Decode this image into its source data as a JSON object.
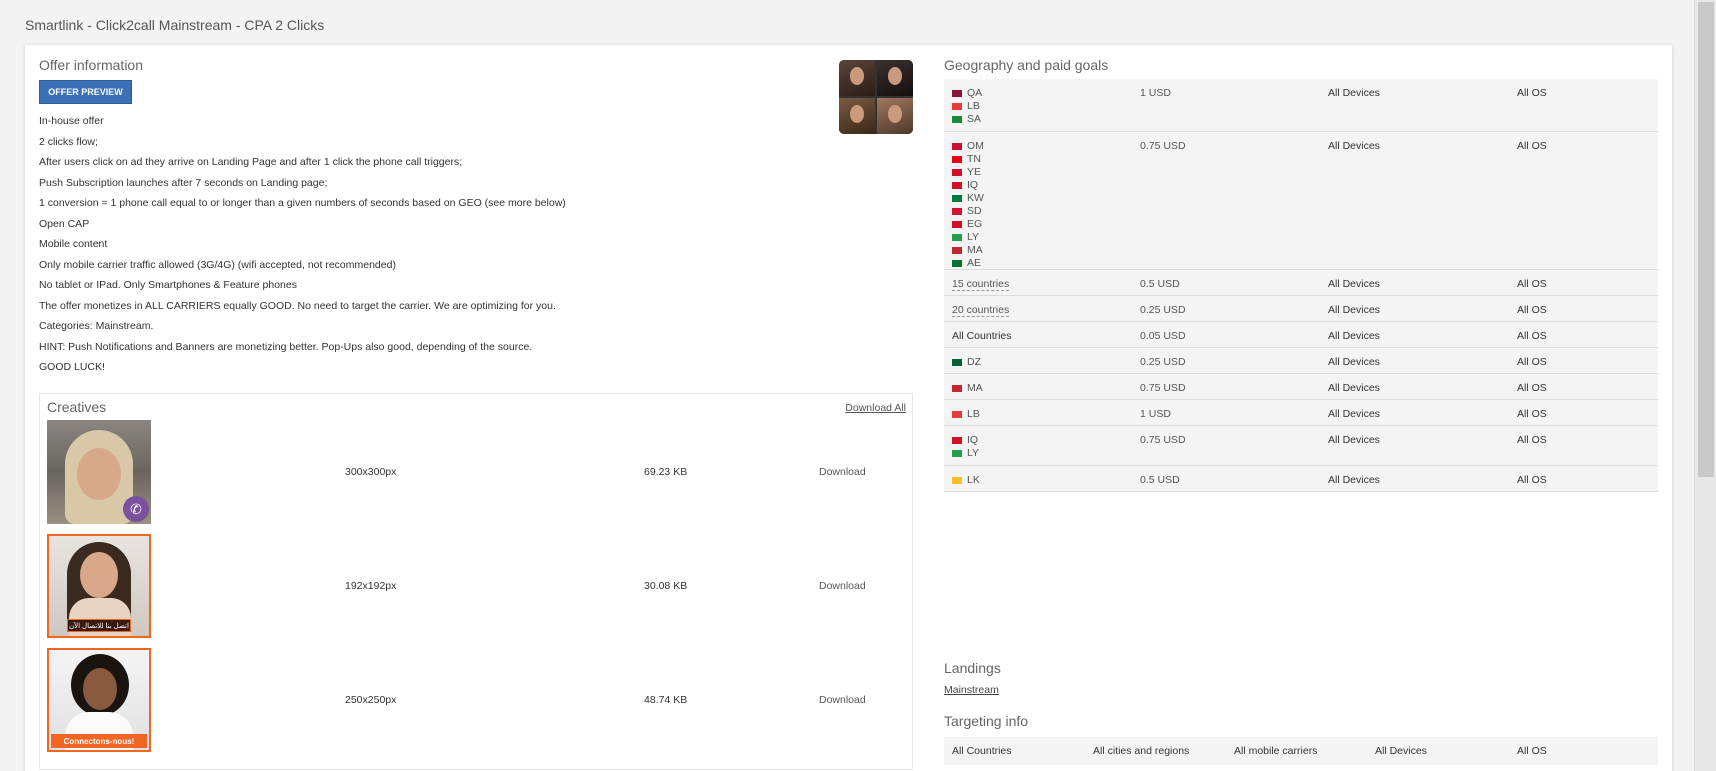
{
  "page": {
    "title": "Smartlink - Click2call Mainstream - CPA 2 Clicks"
  },
  "offer": {
    "title": "Offer information",
    "preview_button": "OFFER PREVIEW",
    "lines": [
      "In-house offer",
      "2 clicks flow;",
      "After users click on ad they arrive on Landing Page and after 1 click the phone call triggers;",
      "Push Subscription launches after 7 seconds on Landing page;",
      "1 conversion = 1 phone call equal to or longer than a given numbers of seconds based on GEO (see more below)",
      "Open CAP",
      "Mobile content",
      "Only mobile carrier traffic allowed (3G/4G) (wifi accepted, not recommended)",
      "No tablet or IPad. Only Smartphones & Feature phones",
      "The offer monetizes in ALL CARRIERS equally GOOD. No need to target the carrier. We are optimizing for you.",
      "Categories: Mainstream.",
      "HINT: Push Notifications and Banners are monetizing better. Pop-Ups also good, depending of the source.",
      "GOOD LUCK!"
    ]
  },
  "creatives": {
    "title": "Creatives",
    "download_all": "Download All",
    "items": [
      {
        "dims": "300x300px",
        "size": "69.23 KB",
        "download": "Download"
      },
      {
        "dims": "192x192px",
        "size": "30.08 KB",
        "download": "Download",
        "banner": "اتصل بنا للاتصال الآن"
      },
      {
        "dims": "250x250px",
        "size": "48.74 KB",
        "download": "Download",
        "banner": "Connectons-nous!"
      }
    ]
  },
  "geo": {
    "title": "Geography and paid goals",
    "rows": [
      {
        "countries": [
          "QA",
          "LB",
          "SA"
        ],
        "payout": "1 USD",
        "devices": "All Devices",
        "os": "All OS"
      },
      {
        "countries": [
          "OM",
          "TN",
          "YE",
          "IQ",
          "KW",
          "SD",
          "EG",
          "LY",
          "MA",
          "AE"
        ],
        "payout": "0.75 USD",
        "devices": "All Devices",
        "os": "All OS"
      },
      {
        "group": "15 countries",
        "payout": "0.5 USD",
        "devices": "All Devices",
        "os": "All OS"
      },
      {
        "group": "20 countries",
        "payout": "0.25 USD",
        "devices": "All Devices",
        "os": "All OS"
      },
      {
        "plain": "All Countries",
        "payout": "0.05 USD",
        "devices": "All Devices",
        "os": "All OS"
      },
      {
        "countries": [
          "DZ"
        ],
        "payout": "0.25 USD",
        "devices": "All Devices",
        "os": "All OS"
      },
      {
        "countries": [
          "MA"
        ],
        "payout": "0.75 USD",
        "devices": "All Devices",
        "os": "All OS"
      },
      {
        "countries": [
          "LB"
        ],
        "payout": "1 USD",
        "devices": "All Devices",
        "os": "All OS"
      },
      {
        "countries": [
          "IQ",
          "LY"
        ],
        "payout": "0.75 USD",
        "devices": "All Devices",
        "os": "All OS"
      },
      {
        "countries": [
          "LK"
        ],
        "payout": "0.5 USD",
        "devices": "All Devices",
        "os": "All OS"
      }
    ]
  },
  "landings": {
    "title": "Landings",
    "link": "Mainstream"
  },
  "targeting": {
    "title": "Targeting info",
    "countries": "All Countries",
    "regions": "All cities and regions",
    "carriers": "All mobile carriers",
    "devices": "All Devices",
    "os": "All OS"
  },
  "flag_colors": {
    "QA": "#8a1538",
    "LB": "#e63b3b",
    "SA": "#1a8a3a",
    "OM": "#c8102e",
    "TN": "#e70013",
    "YE": "#ce1126",
    "IQ": "#ce1126",
    "KW": "#007a3d",
    "SD": "#d21034",
    "EG": "#ce1126",
    "LY": "#239e46",
    "MA": "#c1272d",
    "AE": "#00732f",
    "DZ": "#006233",
    "LK": "#ffbe29"
  }
}
